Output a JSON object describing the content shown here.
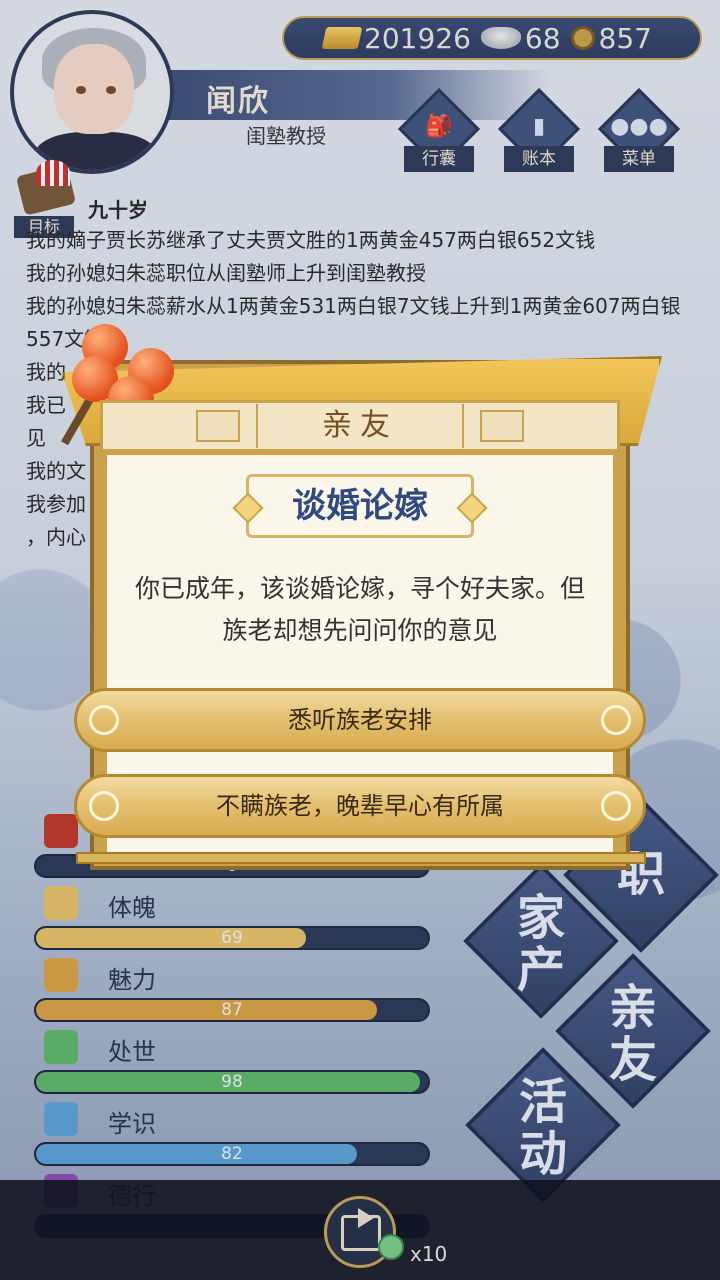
{
  "header": {
    "name": "闻欣",
    "title": "闺塾教授",
    "currency": {
      "gold": "201926",
      "silver": "68",
      "coin": "857"
    },
    "menu": [
      {
        "label": "行囊",
        "glyph": "🎒",
        "icon": "bag-icon"
      },
      {
        "label": "账本",
        "glyph": "▮",
        "icon": "ledger-icon"
      },
      {
        "label": "菜单",
        "glyph": "●●●",
        "icon": "more-icon"
      }
    ],
    "goal_label": "目标",
    "age": "九十岁"
  },
  "log": [
    "我的嫡子贾长苏继承了丈夫贾文胜的1两黄金457两白银652文钱",
    "我的孙媳妇朱蕊职位从闺塾师上升到闺塾教授",
    "我的孙媳妇朱蕊薪水从1两黄金531两白银7文钱上升到1两黄金607两白银557文钱",
    "我的",
    "我已",
    "见",
    "我的文",
    "我参加",
    "，内心"
  ],
  "stats": [
    {
      "name": "",
      "value": "0",
      "pct": 0,
      "color": "#c0392b",
      "icon": "flower-icon"
    },
    {
      "name": "体魄",
      "value": "69",
      "pct": 0.69,
      "color": "#e7c46b",
      "icon": "body-icon"
    },
    {
      "name": "魅力",
      "value": "87",
      "pct": 0.87,
      "color": "#d9a245",
      "icon": "charm-icon"
    },
    {
      "name": "处世",
      "value": "98",
      "pct": 0.98,
      "color": "#5fb86a",
      "icon": "worldly-icon"
    },
    {
      "name": "学识",
      "value": "82",
      "pct": 0.82,
      "color": "#5ea4d8",
      "icon": "knowledge-icon"
    },
    {
      "name": "德行",
      "value": "",
      "pct": 0,
      "color": "#8a4fb0",
      "icon": "virtue-icon"
    }
  ],
  "side_buttons": [
    {
      "label": "家\n产"
    },
    {
      "label": "亲\n友"
    },
    {
      "label": "活\n动"
    },
    {
      "label": "职"
    }
  ],
  "dialog": {
    "header": "亲友",
    "topic": "谈婚论嫁",
    "text": "你已成年，该谈婚论嫁，寻个好夫家。但族老却想先问问你的意见",
    "choices": [
      "悉听族老安排",
      "不瞒族老，晚辈早心有所属"
    ]
  },
  "bottom": {
    "multiplier": "x10"
  }
}
